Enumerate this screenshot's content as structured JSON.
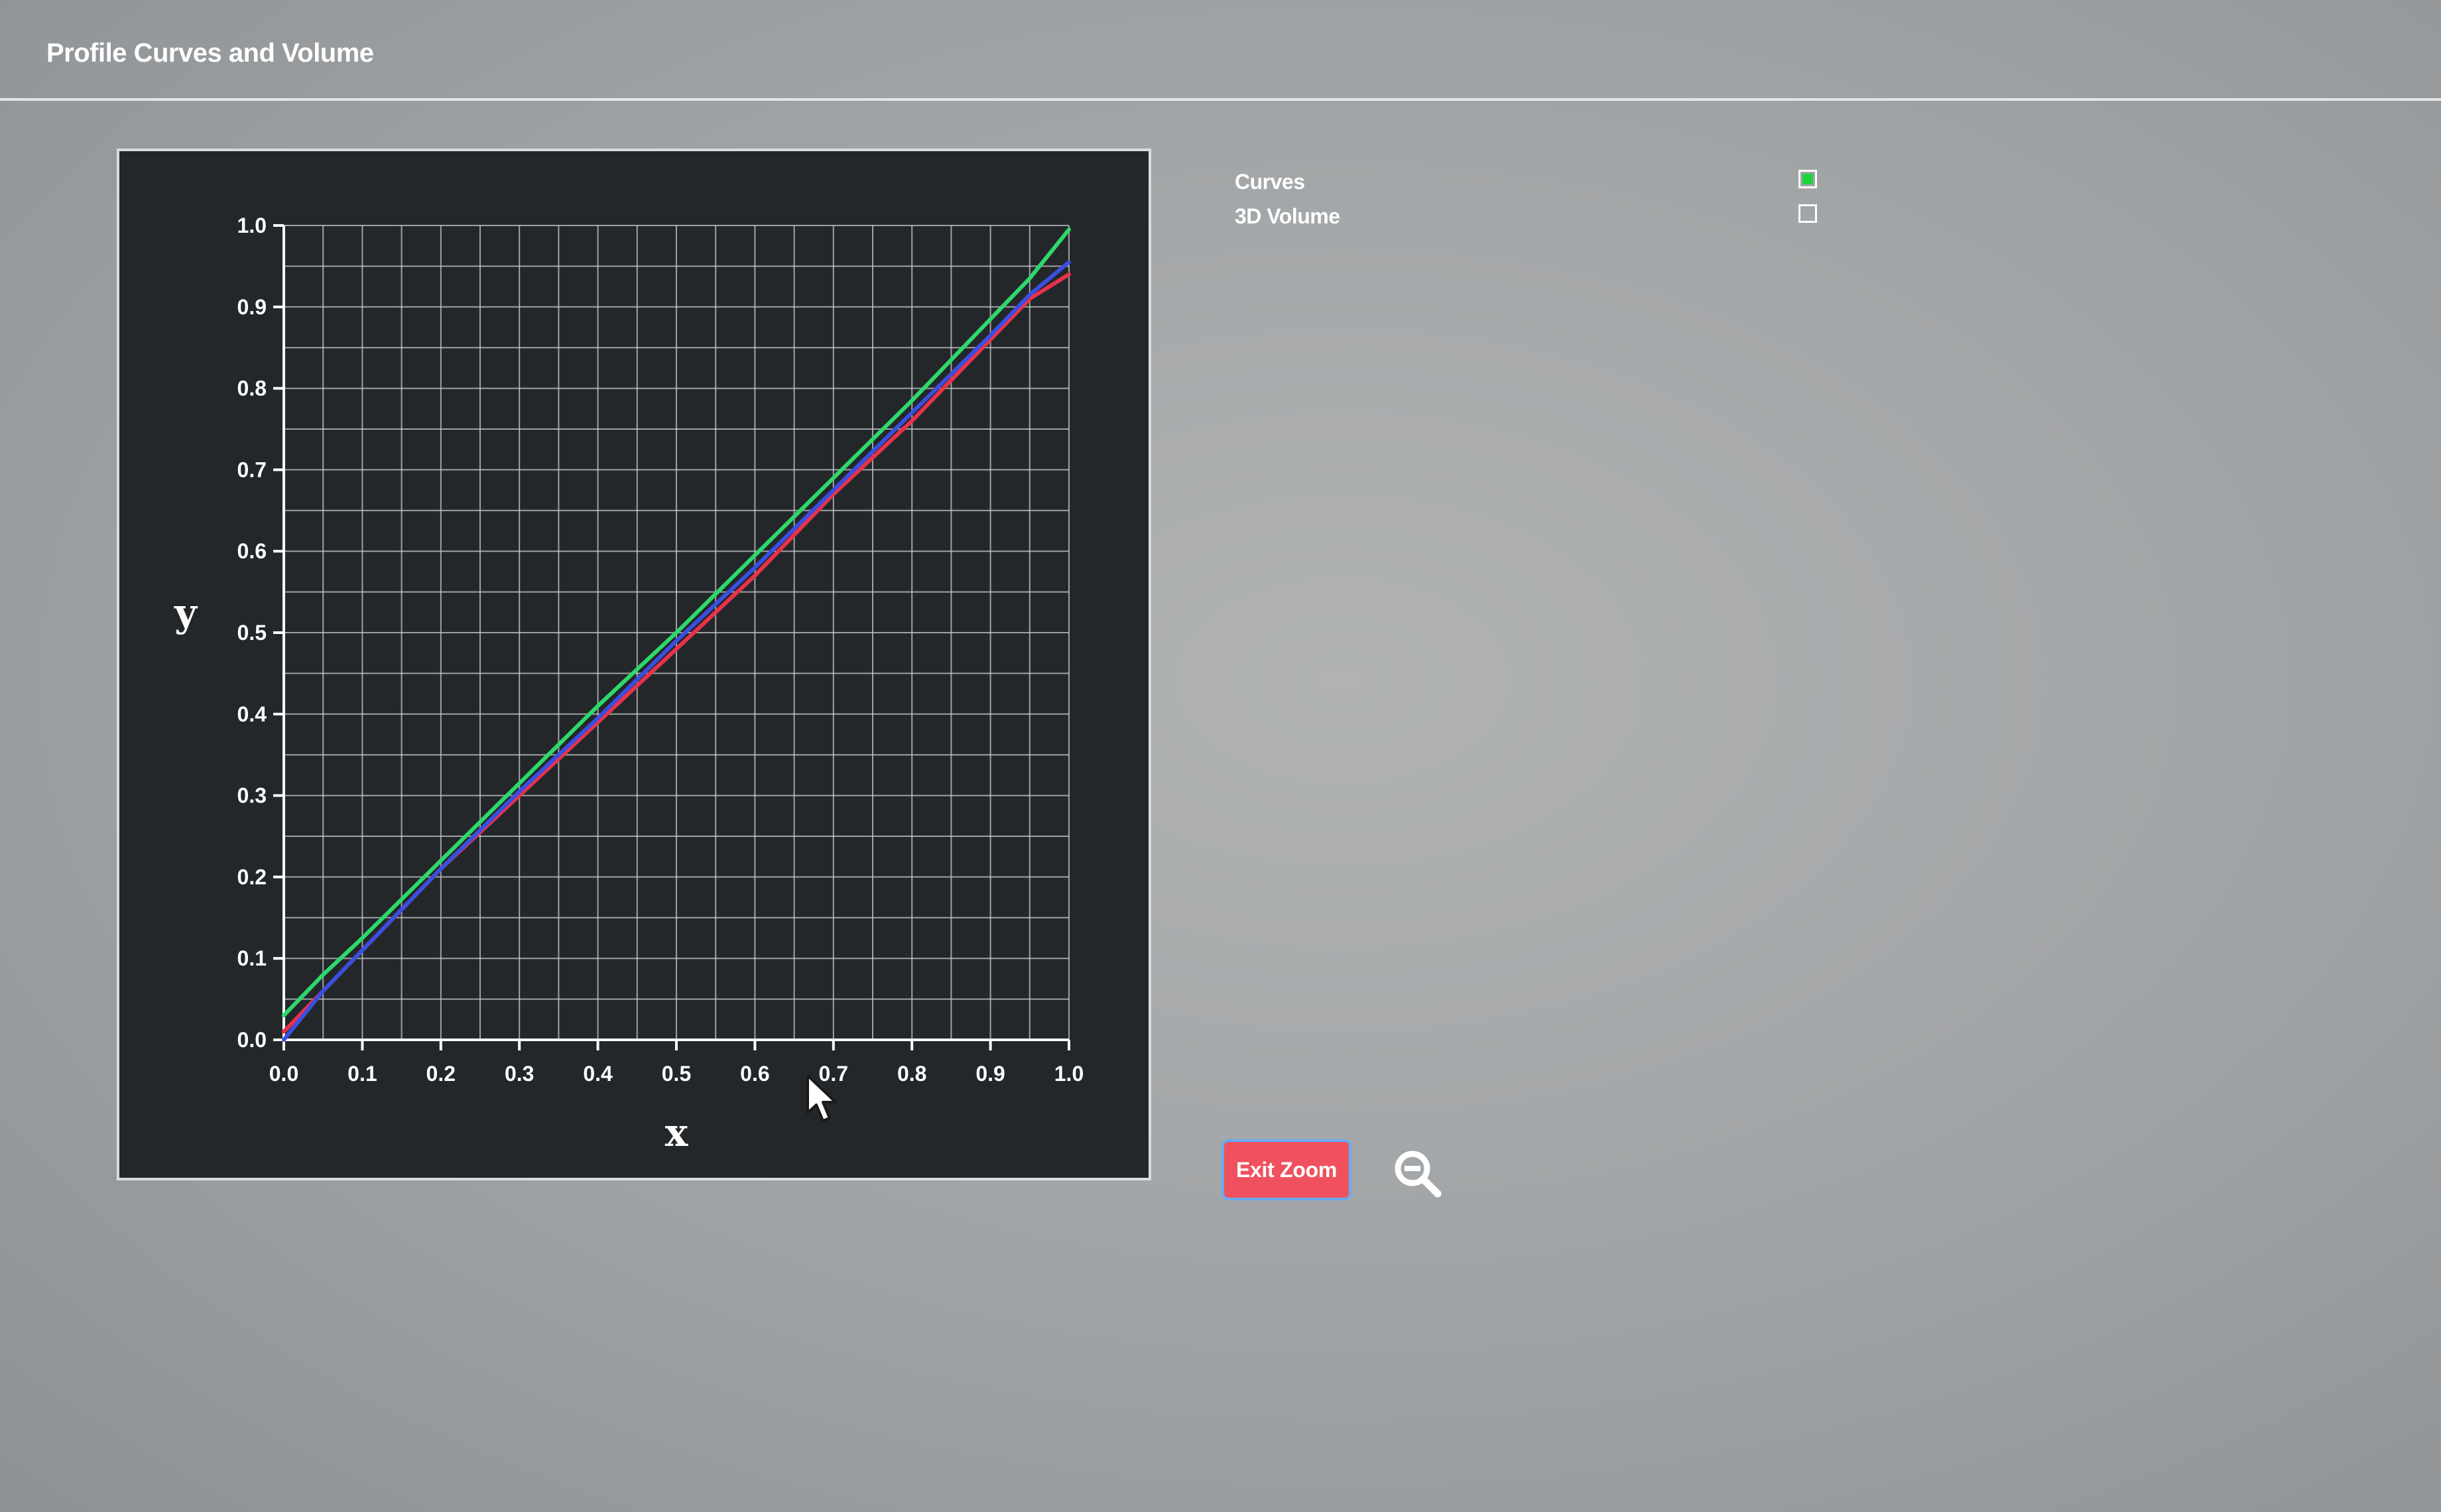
{
  "window": {
    "title": "Profile Curves and Volume"
  },
  "toggles": {
    "curves_label": "Curves",
    "volume_label": "3D Volume",
    "curves_checked": true,
    "volume_checked": false,
    "checked_color": "#1fd43a"
  },
  "buttons": {
    "exit_zoom_label": "Exit Zoom",
    "exit_zoom_color": "#f0515e"
  },
  "icons": {
    "zoom_out": "magnifier-minus-icon",
    "cursor": "mouse-pointer-icon"
  },
  "chart_data": {
    "type": "line",
    "title": "",
    "xlabel": "x",
    "ylabel": "y",
    "xlim": [
      0.0,
      1.0
    ],
    "ylim": [
      0.0,
      1.0
    ],
    "grid": true,
    "xticks": [
      "0.0",
      "0.1",
      "0.2",
      "0.3",
      "0.4",
      "0.5",
      "0.6",
      "0.7",
      "0.8",
      "0.9",
      "1.0"
    ],
    "yticks": [
      "0.0",
      "0.1",
      "0.2",
      "0.3",
      "0.4",
      "0.5",
      "0.6",
      "0.7",
      "0.8",
      "0.9",
      "1.0"
    ],
    "series": [
      {
        "color": "#e8324a",
        "x": [
          0.0,
          0.05,
          0.1,
          0.2,
          0.3,
          0.4,
          0.5,
          0.6,
          0.7,
          0.8,
          0.9,
          0.95,
          1.0
        ],
        "y": [
          0.01,
          0.06,
          0.11,
          0.21,
          0.3,
          0.39,
          0.48,
          0.57,
          0.67,
          0.76,
          0.86,
          0.91,
          0.94
        ]
      },
      {
        "color": "#3a4fe0",
        "x": [
          0.0,
          0.05,
          0.1,
          0.2,
          0.3,
          0.4,
          0.5,
          0.6,
          0.7,
          0.8,
          0.9,
          0.95,
          1.0
        ],
        "y": [
          0.0,
          0.06,
          0.11,
          0.21,
          0.305,
          0.395,
          0.49,
          0.58,
          0.675,
          0.77,
          0.865,
          0.915,
          0.955
        ]
      },
      {
        "color": "#2ed86a",
        "x": [
          0.0,
          0.05,
          0.1,
          0.2,
          0.3,
          0.4,
          0.5,
          0.6,
          0.7,
          0.8,
          0.9,
          0.95,
          1.0
        ],
        "y": [
          0.03,
          0.08,
          0.125,
          0.22,
          0.315,
          0.41,
          0.5,
          0.595,
          0.69,
          0.785,
          0.885,
          0.935,
          0.995
        ]
      }
    ]
  }
}
